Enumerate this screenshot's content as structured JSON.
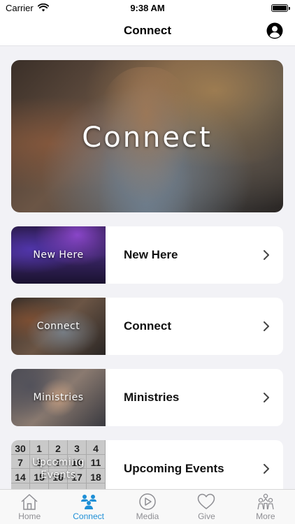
{
  "status_bar": {
    "carrier": "Carrier",
    "time": "9:38 AM",
    "battery_level": 1.0
  },
  "nav": {
    "title": "Connect",
    "profile_icon": "person-circle-icon"
  },
  "hero": {
    "title": "Connect"
  },
  "cards": [
    {
      "thumb_label": "New Here",
      "title": "New Here"
    },
    {
      "thumb_label": "Connect",
      "title": "Connect"
    },
    {
      "thumb_label": "Ministries",
      "title": "Ministries"
    },
    {
      "thumb_label": "Upcoming\nEvents",
      "title": "Upcoming Events"
    }
  ],
  "calendar_numbers": [
    "30",
    "1",
    "2",
    "3",
    "4",
    "7",
    "8",
    "9",
    "10",
    "11",
    "14",
    "15",
    "16",
    "17",
    "18",
    "",
    "",
    "",
    "",
    ""
  ],
  "tabs": [
    {
      "label": "Home",
      "icon": "home-icon",
      "active": false
    },
    {
      "label": "Connect",
      "icon": "people-icon",
      "active": true
    },
    {
      "label": "Media",
      "icon": "play-icon",
      "active": false
    },
    {
      "label": "Give",
      "icon": "heart-icon",
      "active": false
    },
    {
      "label": "More",
      "icon": "group-icon",
      "active": false
    }
  ],
  "colors": {
    "accent": "#1e8fd6",
    "inactive": "#8e8e93",
    "background": "#f2f2f6"
  }
}
